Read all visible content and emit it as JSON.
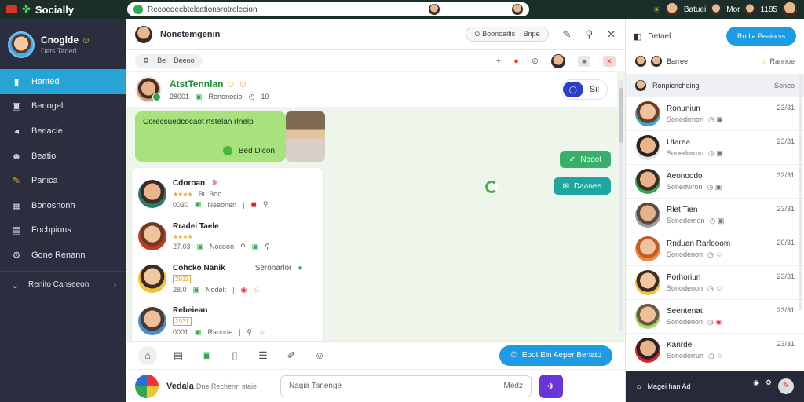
{
  "topbar": {
    "app_name": "Socially",
    "search_placeholder": "Recoedecbtelcationsrotrelecion",
    "user_label": "Batuei",
    "count_label": "Mor",
    "score_label": "1185",
    "accent": "#2fa84f"
  },
  "sidebar": {
    "profile": {
      "name": "Cnoglde",
      "sub": "Dats Taded"
    },
    "items": [
      {
        "label": "Hanted",
        "icon": "home-icon",
        "active": true
      },
      {
        "label": "Benogel",
        "icon": "briefcase-icon"
      },
      {
        "label": "Berlacle",
        "icon": "megaphone-icon"
      },
      {
        "label": "Beatiol",
        "icon": "people-icon"
      },
      {
        "label": "Panica",
        "icon": "pencil-icon"
      },
      {
        "label": "Bonosnonh",
        "icon": "calendar-icon"
      },
      {
        "label": "Fochpions",
        "icon": "folder-icon"
      },
      {
        "label": "Gone Renann",
        "icon": "settings-icon"
      }
    ],
    "more_label": "Renito Canseeon",
    "active_color": "#27a3d6"
  },
  "chat": {
    "title": "Nonetemgenin",
    "header_pill": "Boonoaitis",
    "header_pill_2": "Bnpe",
    "subbar_chip_1": "Be",
    "subbar_chip_2": "Deeoo",
    "contact": {
      "name": "AtstTennlan",
      "id": "28001",
      "status": "Renonocio",
      "count": "10",
      "toggle_label": "Sil"
    },
    "bubble": {
      "text": "Corecsuedcocaot rtstelan rlnelp",
      "foot": "Bed Dlcon"
    },
    "reply_1": "Nooot",
    "reply_2": "Daanee",
    "contacts": [
      {
        "name": "Cdoroan",
        "sub": "Bu Boo",
        "id": "0030",
        "status": "Neebnen"
      },
      {
        "name": "Rradei Taele",
        "sub": "",
        "id": "27.03",
        "status": "Nocoon"
      },
      {
        "name": "Cohcko Nanik",
        "sub": "Seronarlor",
        "id": "28.0",
        "status": "Nodelt"
      },
      {
        "name": "Rebeiean",
        "sub": "",
        "id": "0001",
        "status": "Raonde"
      }
    ],
    "cta_label": "Eoot Ein Aeper Benato",
    "composer": {
      "name": "Vedala",
      "sub": "Dne Recherm staie",
      "input_placeholder": "Nagia Tanenge",
      "input_hint": "Medz"
    }
  },
  "right_panel": {
    "tab_label": "Detael",
    "cta_label": "Rodia Peaiorss",
    "section": "Barree",
    "section_more": "Rannoe",
    "group": {
      "label": "Ronpicncheing",
      "time": "Soneo"
    },
    "conversations": [
      {
        "name": "Ronuniun",
        "msg": "Sonodrrnon",
        "time": "23/31"
      },
      {
        "name": "Utarea",
        "msg": "Sonedorrun",
        "time": "23/31"
      },
      {
        "name": "Aeonoodo",
        "msg": "Sonedwron",
        "time": "32/31"
      },
      {
        "name": "Rlet Tien",
        "msg": "Sonedemen",
        "time": "23/31"
      },
      {
        "name": "Rnduan Rarlooom",
        "msg": "Sonodenon",
        "time": "20/31"
      },
      {
        "name": "Porhoriun",
        "msg": "Sonodenon",
        "time": "23/31"
      },
      {
        "name": "Seentenat",
        "msg": "Sonodenon",
        "time": "23/31"
      },
      {
        "name": "Kanrdei",
        "msg": "Sonodorrun",
        "time": "23/31"
      }
    ],
    "bottom_label": "Magei han Ad"
  }
}
